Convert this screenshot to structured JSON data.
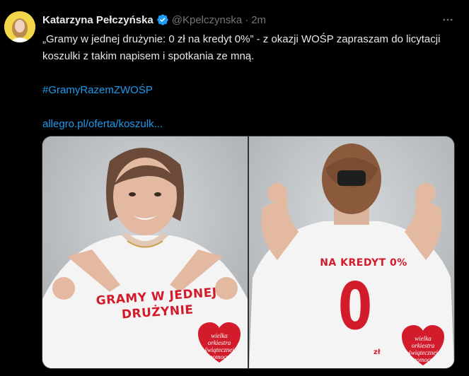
{
  "tweet": {
    "author_name": "Katarzyna Pełczyńska",
    "handle": "@Kpelczynska",
    "separator": "·",
    "time": "2m",
    "text_line": "„Gramy w jednej drużynie: 0 zł na kredyt 0%” - z okazji WOŚP zapraszam do licytacji koszulki z takim napisem i spotkania ze mną.",
    "hashtag": "#GramyRazemZWOŚP",
    "link": "allegro.pl/oferta/koszulk..."
  },
  "media": {
    "left_shirt_text": "GRAMY W JEDNEJ DRUŻYNIE",
    "right_shirt_text": "NA KREDYT 0%",
    "right_shirt_number": "0",
    "right_shirt_unit": "zł",
    "wosp_logo_text": "wielka orkiestra świątecznej pomocy"
  },
  "colors": {
    "background": "#000000",
    "text": "#e7e9ea",
    "secondary_text": "#71767b",
    "link": "#1d9bf0",
    "verified_badge": "#1d9bf0",
    "shirt_print": "#d21c2b"
  },
  "icons": {
    "verified": "verified-badge-icon",
    "more": "more-options-icon"
  }
}
